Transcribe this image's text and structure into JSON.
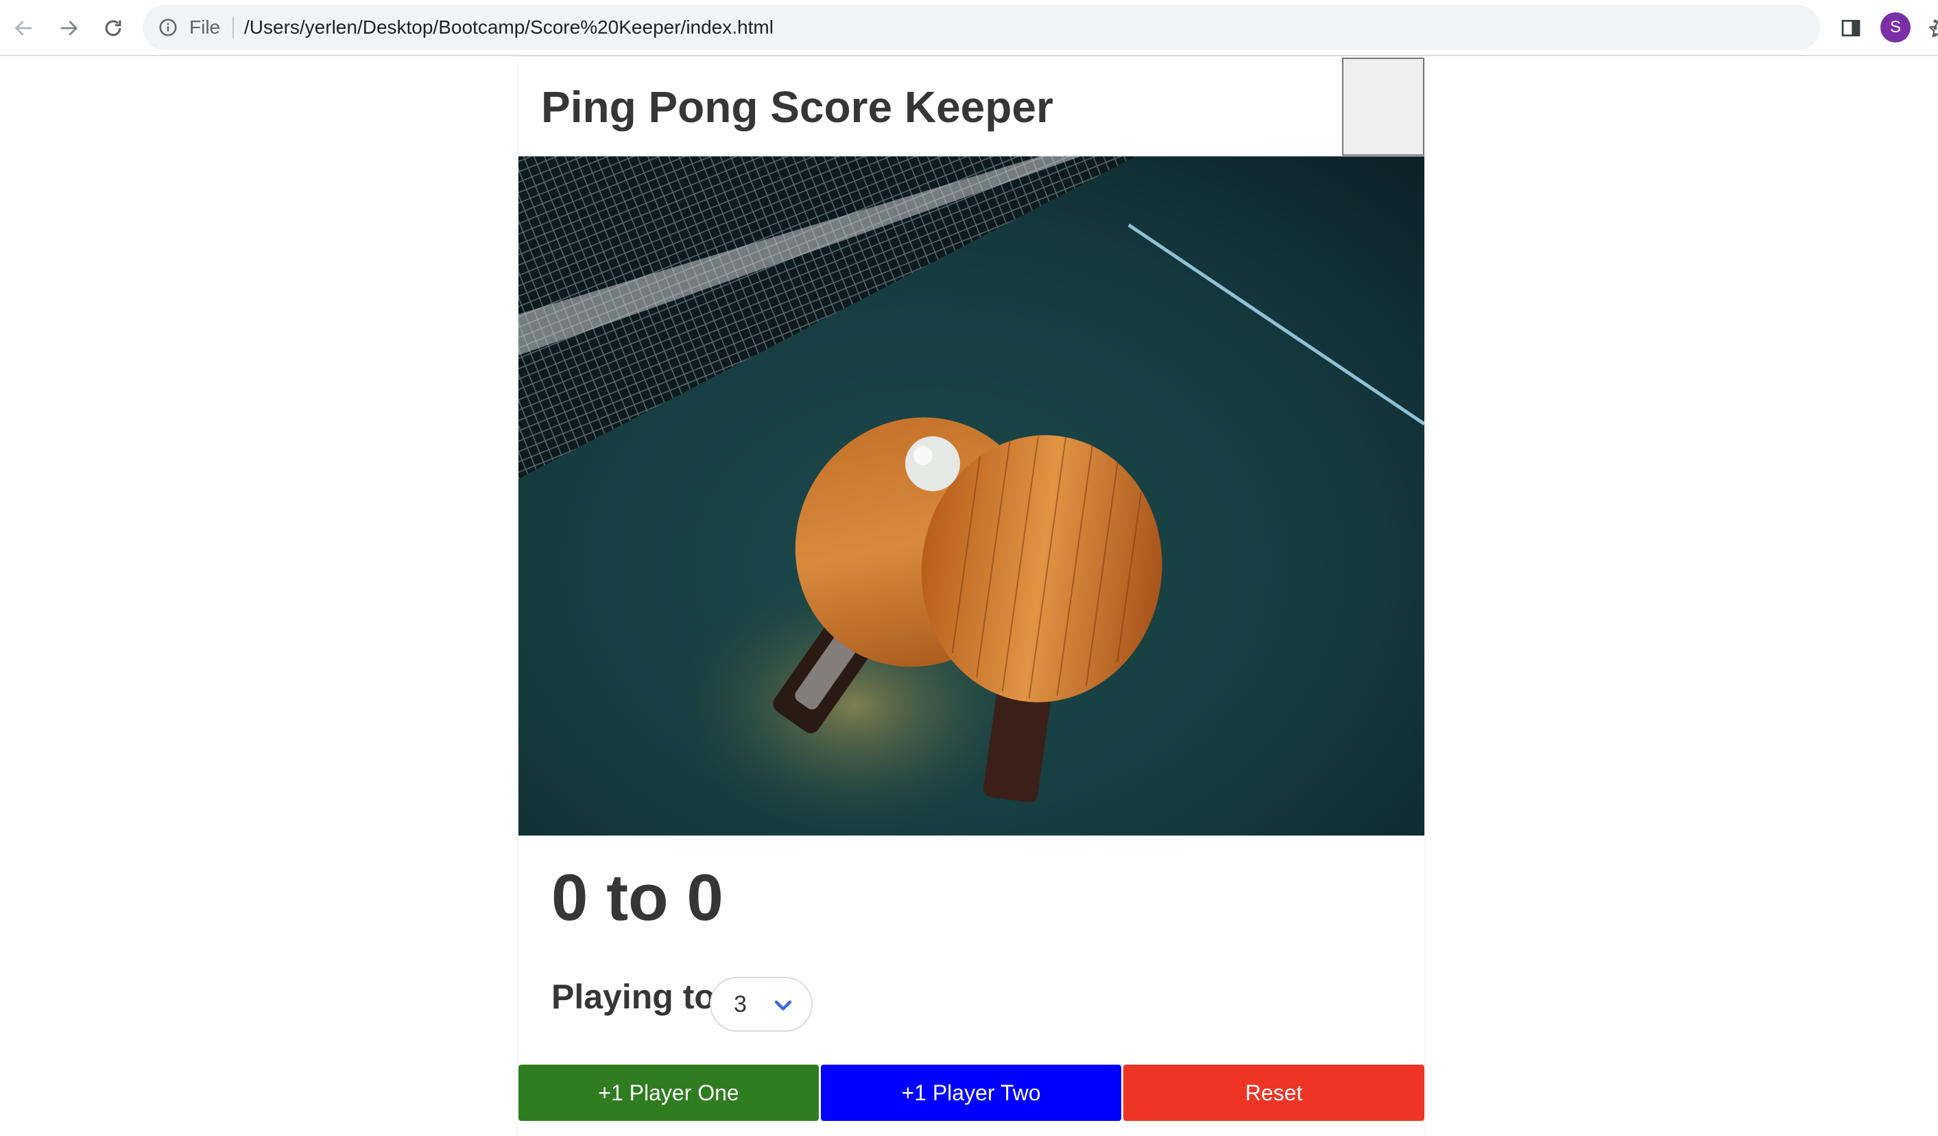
{
  "browser": {
    "scheme_label": "File",
    "url": "/Users/yerlen/Desktop/Bootcamp/Score%20Keeper/index.html",
    "avatar_initial": "S",
    "avatar_color": "#7b2fa6",
    "icons": [
      "back-arrow-icon",
      "forward-arrow-icon",
      "reload-icon",
      "info-icon",
      "share-icon",
      "star-icon",
      "side-panel-icon",
      "menu-icon"
    ]
  },
  "page": {
    "title": "Ping Pong Score Keeper",
    "hero_image": "ping-pong-paddles-and-ball-on-table",
    "score": {
      "player_one": 0,
      "separator": "to",
      "player_two": 0,
      "display": "0 to 0"
    },
    "playing_to": {
      "label": "Playing to",
      "selected": "3"
    },
    "buttons": {
      "player_one": {
        "label": "+1 Player One",
        "color": "#2f7d20"
      },
      "player_two": {
        "label": "+1 Player Two",
        "color": "#0000ff"
      },
      "reset": {
        "label": "Reset",
        "color": "#ee3424"
      }
    }
  }
}
